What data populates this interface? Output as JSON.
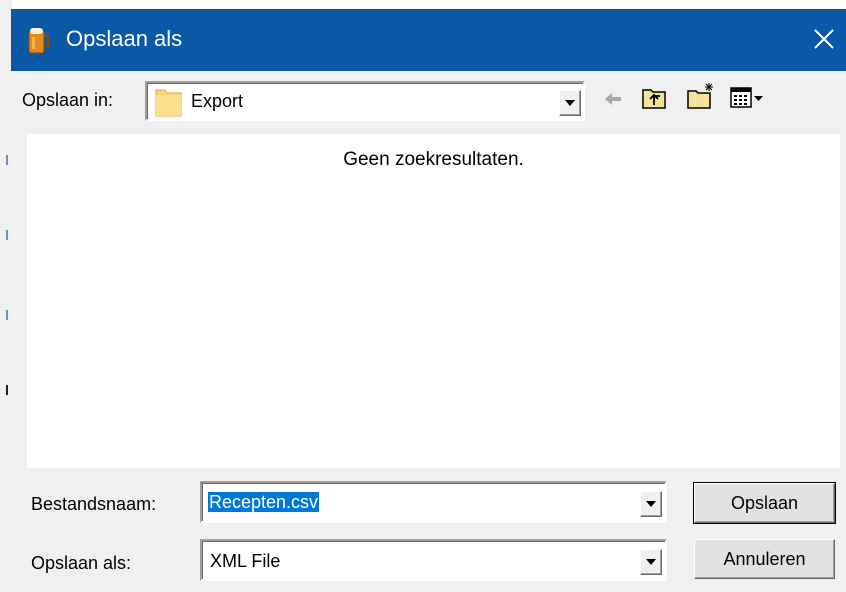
{
  "window": {
    "title": "Opslaan als",
    "close_glyph": "✕"
  },
  "lookin": {
    "label": "Opslaan in:",
    "folder": "Export"
  },
  "toolbar": {
    "icons": [
      "back-arrow-icon",
      "up-folder-icon",
      "new-folder-icon",
      "view-menu-icon"
    ]
  },
  "file_list": {
    "empty_message": "Geen zoekresultaten."
  },
  "filename": {
    "label": "Bestandsnaam:",
    "value": "Recepten.csv"
  },
  "filetype": {
    "label": "Opslaan als:",
    "value": "XML File"
  },
  "buttons": {
    "save": "Opslaan",
    "cancel": "Annuleren"
  },
  "colors": {
    "titlebar": "#0a58a6",
    "selection": "#0078d7",
    "folder": "#f5c542"
  }
}
